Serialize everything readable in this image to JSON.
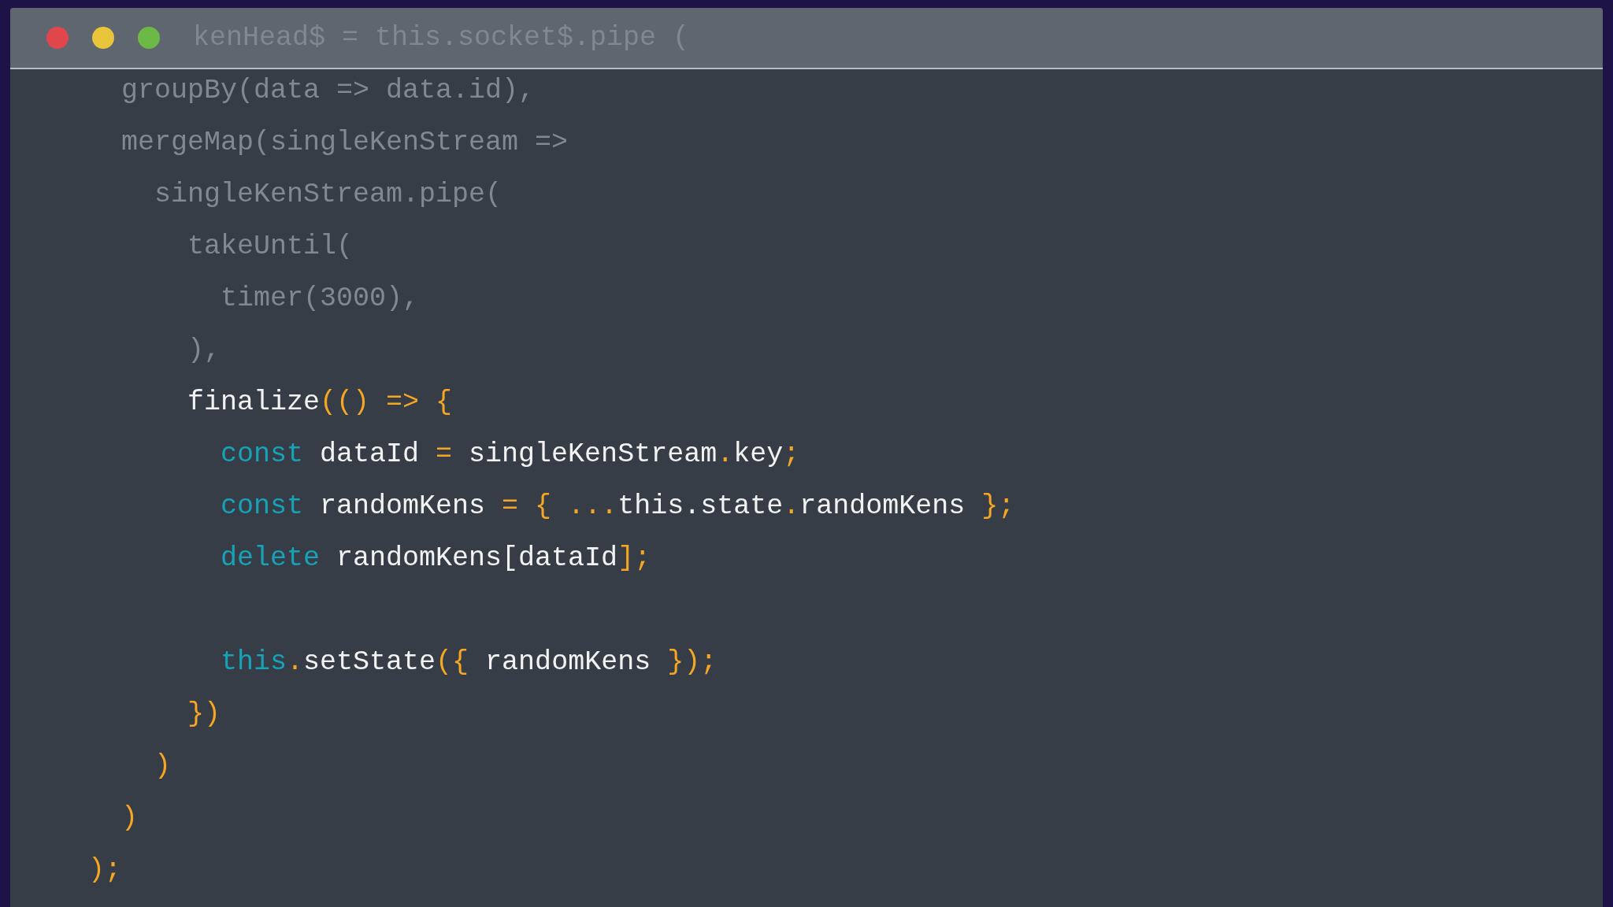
{
  "window": {
    "controls": [
      {
        "kind": "close",
        "color": "#e0474c"
      },
      {
        "kind": "minimize",
        "color": "#e8c53a"
      },
      {
        "kind": "zoom",
        "color": "#6cb947"
      }
    ],
    "overlapped_line": {
      "dim": true,
      "tokens": [
        {
          "kind": "plain",
          "text": "kenHead$ = this.socket$.pipe ("
        }
      ]
    }
  },
  "lines": [
    {
      "kind": "code",
      "dim": true,
      "tokens": [
        {
          "kind": "plain",
          "text": "  groupBy(data => data.id),"
        }
      ]
    },
    {
      "kind": "code",
      "dim": true,
      "tokens": [
        {
          "kind": "plain",
          "text": "  mergeMap(singleKenStream =>"
        }
      ]
    },
    {
      "kind": "code",
      "dim": true,
      "tokens": [
        {
          "kind": "plain",
          "text": "    singleKenStream.pipe("
        }
      ]
    },
    {
      "kind": "code",
      "dim": true,
      "tokens": [
        {
          "kind": "plain",
          "text": "      takeUntil("
        }
      ]
    },
    {
      "kind": "code",
      "dim": true,
      "tokens": [
        {
          "kind": "plain",
          "text": "        timer(3000),"
        }
      ]
    },
    {
      "kind": "code",
      "dim": true,
      "tokens": [
        {
          "kind": "plain",
          "text": "      ),"
        }
      ]
    },
    {
      "kind": "code",
      "dim": false,
      "tokens": [
        {
          "kind": "plain",
          "text": "      finalize"
        },
        {
          "kind": "punct",
          "text": "(() => {"
        }
      ]
    },
    {
      "kind": "code",
      "dim": false,
      "tokens": [
        {
          "kind": "keyword",
          "text": "        const"
        },
        {
          "kind": "plain",
          "text": " dataId "
        },
        {
          "kind": "punct",
          "text": "="
        },
        {
          "kind": "plain",
          "text": " singleKenStream"
        },
        {
          "kind": "punct",
          "text": "."
        },
        {
          "kind": "plain",
          "text": "key"
        },
        {
          "kind": "punct",
          "text": ";"
        }
      ]
    },
    {
      "kind": "code",
      "dim": false,
      "tokens": [
        {
          "kind": "keyword",
          "text": "        const"
        },
        {
          "kind": "plain",
          "text": " randomKens "
        },
        {
          "kind": "punct",
          "text": "= { ..."
        },
        {
          "kind": "plain",
          "text": "this.state"
        },
        {
          "kind": "punct",
          "text": "."
        },
        {
          "kind": "plain",
          "text": "randomKens"
        },
        {
          "kind": "punct",
          "text": " };"
        }
      ]
    },
    {
      "kind": "code",
      "dim": false,
      "tokens": [
        {
          "kind": "keyword",
          "text": "        delete"
        },
        {
          "kind": "plain",
          "text": " randomKens[dataId"
        },
        {
          "kind": "punct",
          "text": "];"
        }
      ]
    },
    {
      "kind": "blank"
    },
    {
      "kind": "code",
      "dim": false,
      "tokens": [
        {
          "kind": "keyword",
          "text": "        this"
        },
        {
          "kind": "punct",
          "text": "."
        },
        {
          "kind": "plain",
          "text": "setState"
        },
        {
          "kind": "punct",
          "text": "({"
        },
        {
          "kind": "plain",
          "text": " randomKens "
        },
        {
          "kind": "punct",
          "text": "});"
        }
      ]
    },
    {
      "kind": "code",
      "dim": false,
      "tokens": [
        {
          "kind": "punct",
          "text": "      })"
        }
      ]
    },
    {
      "kind": "code",
      "dim": false,
      "tokens": [
        {
          "kind": "punct",
          "text": "    )"
        }
      ]
    },
    {
      "kind": "code",
      "dim": false,
      "tokens": [
        {
          "kind": "punct",
          "text": "  )"
        }
      ]
    },
    {
      "kind": "code",
      "dim": false,
      "tokens": [
        {
          "kind": "punct",
          "text": ");"
        }
      ]
    }
  ]
}
